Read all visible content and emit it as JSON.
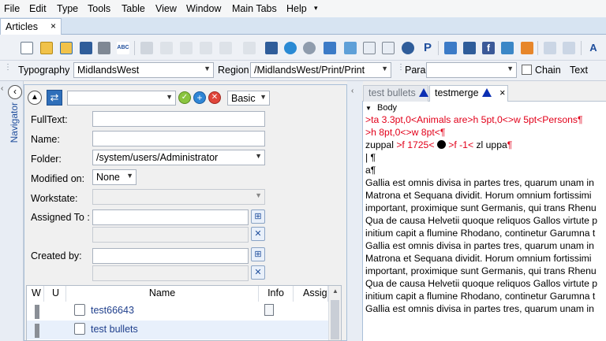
{
  "menu": [
    "File",
    "Edit",
    "Type",
    "Tools",
    "Table",
    "View",
    "Window",
    "Main Tabs",
    "Help"
  ],
  "tabs": {
    "articles": "Articles",
    "close": "×"
  },
  "typography": {
    "label": "Typography",
    "value": "MidlandsWest",
    "region_label": "Region",
    "region_value": "/MidlandsWest/Print/Print",
    "para_label": "Para",
    "para_value": "",
    "chain_label": "Chain",
    "text_label": "Text"
  },
  "navigator": {
    "label": "Navigator"
  },
  "search": {
    "mode": "Basic",
    "fulltext_label": "FullText:",
    "fulltext_value": "",
    "name_label": "Name:",
    "name_value": "",
    "folder_label": "Folder:",
    "folder_value": "/system/users/Administrator",
    "modified_label": "Modified on:",
    "modified_value": "None",
    "workstate_label": "Workstate:",
    "workstate_value": "",
    "assigned_label": "Assigned To :",
    "assigned_value": "",
    "created_label": "Created by:",
    "created_value": ""
  },
  "results": {
    "columns": [
      "W",
      "U",
      "Name",
      "Info",
      "Assig"
    ],
    "rows": [
      {
        "name": "test66643"
      },
      {
        "name": "test bullets"
      }
    ]
  },
  "right_tabs": [
    {
      "label": "test bullets"
    },
    {
      "label": "testmerge"
    }
  ],
  "editor": {
    "section": "Body",
    "lines": [
      ">ta 3.3pt,0<Animals are>h 5pt,0<>w 5pt<Persons¶",
      ">h 8pt,0<>w 8pt<¶",
      "zuppal  >f 1725<  >f -1<  zl   uppa¶",
      " | ¶",
      "a¶",
      "Gallia est omnis divisa in partes tres, quarum unam in",
      "Matrona et Sequana dividit. Horum omnium fortissimi",
      "important, proximique sunt Germanis, qui trans Rhenu",
      "Qua de causa Helvetii quoque reliquos Gallos virtute p",
      "initium capit a flumine Rhodano, continetur Garumna t",
      "Gallia est omnis divisa in partes tres, quarum unam in",
      "Matrona et Sequana dividit. Horum omnium fortissimi",
      "important, proximique sunt Germanis, qui trans Rhenu",
      "Qua de causa Helvetii quoque reliquos Gallos virtute p",
      "initium capit a flumine Rhodano, continetur Garumna t",
      "Gallia est omnis divisa in partes tres, quarum unam in"
    ]
  }
}
